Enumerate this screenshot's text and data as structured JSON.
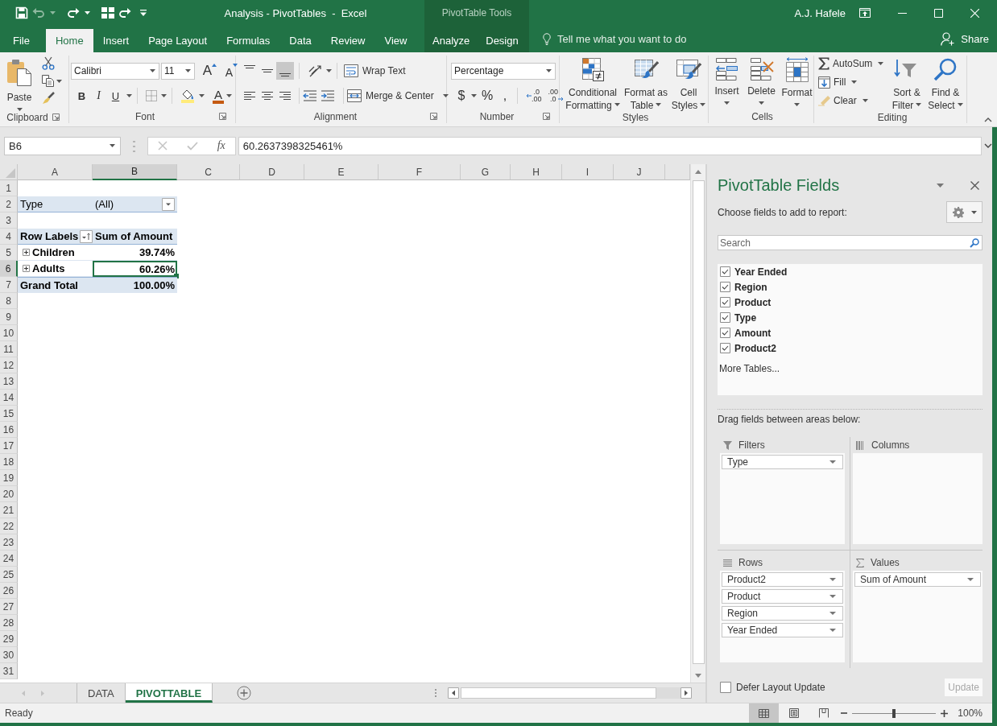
{
  "title_bar": {
    "quick_access": [
      {
        "kind": "save",
        "disabled": false
      },
      {
        "kind": "undo",
        "disabled": true
      },
      {
        "kind": "redo",
        "disabled": false
      },
      {
        "kind": "layout",
        "disabled": false
      },
      {
        "kind": "repeat",
        "disabled": false
      },
      {
        "kind": "customize",
        "disabled": false
      }
    ],
    "title": "Analysis - PivotTables  -  Excel",
    "context_group": "PivotTable Tools",
    "user": "A.J. Hafele"
  },
  "ribbon_tabs": [
    {
      "label": "File",
      "selected": false,
      "contextual": false
    },
    {
      "label": "Home",
      "selected": true,
      "contextual": false
    },
    {
      "label": "Insert",
      "selected": false,
      "contextual": false
    },
    {
      "label": "Page Layout",
      "selected": false,
      "contextual": false
    },
    {
      "label": "Formulas",
      "selected": false,
      "contextual": false
    },
    {
      "label": "Data",
      "selected": false,
      "contextual": false
    },
    {
      "label": "Review",
      "selected": false,
      "contextual": false
    },
    {
      "label": "View",
      "selected": false,
      "contextual": false
    },
    {
      "label": "Analyze",
      "selected": false,
      "contextual": true
    },
    {
      "label": "Design",
      "selected": false,
      "contextual": true
    }
  ],
  "tell_me": {
    "placeholder": "Tell me what you want to do"
  },
  "share_button": {
    "label": "Share"
  },
  "ribbon": {
    "groups": [
      {
        "kind": "clipboard",
        "label": "Clipboard",
        "launcher": true,
        "paste": "Paste"
      },
      {
        "kind": "font",
        "label": "Font",
        "launcher": true,
        "font_name": "Calibri",
        "font_size": "11",
        "grow_font": "A",
        "shrink_font": "A",
        "bold": "B",
        "italic": "I",
        "underline": "U",
        "font_color": "A"
      },
      {
        "kind": "alignment",
        "label": "Alignment",
        "launcher": true,
        "vertical_align": [
          {
            "kind": "top",
            "selected": false
          },
          {
            "kind": "middle",
            "selected": false
          },
          {
            "kind": "bottom",
            "selected": true
          }
        ],
        "horizontal_align": [
          {
            "kind": "left",
            "selected": false
          },
          {
            "kind": "center",
            "selected": false
          },
          {
            "kind": "right",
            "selected": false
          }
        ],
        "wrap_text": "Wrap Text",
        "merge_center": "Merge & Center"
      },
      {
        "kind": "number",
        "label": "Number",
        "launcher": true,
        "format": "Percentage",
        "currency": "$",
        "percent": "%",
        "comma": ",",
        "increase_decimal": [
          ".0",
          ".00"
        ],
        "decrease_decimal": [
          ".00",
          ".0"
        ]
      },
      {
        "kind": "styles",
        "label": "Styles",
        "launcher": false,
        "buttons": [
          {
            "kind": "conditional_formatting",
            "label": "Conditional Formatting"
          },
          {
            "kind": "format_as_table",
            "label": "Format as Table"
          },
          {
            "kind": "cell_styles",
            "label": "Cell Styles"
          }
        ]
      },
      {
        "kind": "cells",
        "label": "Cells",
        "launcher": false,
        "buttons": [
          {
            "kind": "insert",
            "label": "Insert"
          },
          {
            "kind": "delete",
            "label": "Delete"
          },
          {
            "kind": "format",
            "label": "Format"
          }
        ]
      },
      {
        "kind": "editing",
        "label": "Editing",
        "launcher": false,
        "small_buttons": [
          {
            "kind": "autosum",
            "label": "AutoSum"
          },
          {
            "kind": "fill",
            "label": "Fill"
          },
          {
            "kind": "clear",
            "label": "Clear"
          }
        ],
        "buttons": [
          {
            "kind": "sort_filter",
            "label": "Sort & Filter"
          },
          {
            "kind": "find_select",
            "label": "Find & Select"
          }
        ]
      }
    ]
  },
  "formula_bar": {
    "name_box": "B6",
    "buttons": [
      {
        "kind": "cancel",
        "disabled": true
      },
      {
        "kind": "enter",
        "disabled": true
      }
    ],
    "function_label": "fx",
    "value": "60.2637398325461%"
  },
  "sheet": {
    "columns": [
      {
        "label": "A",
        "selected": false
      },
      {
        "label": "B",
        "selected": true
      },
      {
        "label": "C",
        "selected": false
      },
      {
        "label": "D",
        "selected": false
      },
      {
        "label": "E",
        "selected": false
      },
      {
        "label": "F",
        "selected": false
      },
      {
        "label": "G",
        "selected": false
      },
      {
        "label": "H",
        "selected": false
      },
      {
        "label": "I",
        "selected": false
      },
      {
        "label": "J",
        "selected": false
      }
    ],
    "rows": [
      {
        "label": "1",
        "selected": false
      },
      {
        "label": "2",
        "selected": false
      },
      {
        "label": "3",
        "selected": false
      },
      {
        "label": "4",
        "selected": false
      },
      {
        "label": "5",
        "selected": false
      },
      {
        "label": "6",
        "selected": true
      },
      {
        "label": "7",
        "selected": false
      },
      {
        "label": "8",
        "selected": false
      },
      {
        "label": "9",
        "selected": false
      },
      {
        "label": "10",
        "selected": false
      },
      {
        "label": "11",
        "selected": false
      },
      {
        "label": "12",
        "selected": false
      },
      {
        "label": "13",
        "selected": false
      },
      {
        "label": "14",
        "selected": false
      },
      {
        "label": "15",
        "selected": false
      },
      {
        "label": "16",
        "selected": false
      },
      {
        "label": "17",
        "selected": false
      },
      {
        "label": "18",
        "selected": false
      },
      {
        "label": "19",
        "selected": false
      },
      {
        "label": "20",
        "selected": false
      },
      {
        "label": "21",
        "selected": false
      },
      {
        "label": "22",
        "selected": false
      },
      {
        "label": "23",
        "selected": false
      },
      {
        "label": "24",
        "selected": false
      },
      {
        "label": "25",
        "selected": false
      },
      {
        "label": "26",
        "selected": false
      },
      {
        "label": "27",
        "selected": false
      },
      {
        "label": "28",
        "selected": false
      },
      {
        "label": "29",
        "selected": false
      },
      {
        "label": "30",
        "selected": false
      },
      {
        "label": "31",
        "selected": false
      }
    ]
  },
  "pivot_table": {
    "filter": {
      "field": "Type",
      "value": "(All)"
    },
    "header": {
      "row_labels": "Row Labels",
      "values_label": "Sum of Amount"
    },
    "items": [
      {
        "label": "Children",
        "value": "39.74%",
        "expanded": false,
        "selected": false
      },
      {
        "label": "Adults",
        "value": "60.26%",
        "expanded": false,
        "selected": true
      }
    ],
    "grand_total": {
      "label": "Grand Total",
      "value": "100.00%"
    }
  },
  "sheet_tabs": [
    {
      "label": "DATA",
      "selected": false
    },
    {
      "label": "PIVOTTABLE",
      "selected": true
    }
  ],
  "pivot_fields": {
    "title": "PivotTable Fields",
    "subtitle": "Choose fields to add to report:",
    "search": {
      "placeholder": "Search"
    },
    "fields": [
      {
        "label": "Year Ended",
        "checked": true
      },
      {
        "label": "Region",
        "checked": true
      },
      {
        "label": "Product",
        "checked": true
      },
      {
        "label": "Type",
        "checked": true
      },
      {
        "label": "Amount",
        "checked": true
      },
      {
        "label": "Product2",
        "checked": true
      }
    ],
    "more_tables": "More Tables...",
    "areas_hint": "Drag fields between areas below:",
    "areas": [
      {
        "kind": "filters",
        "label": "Filters",
        "items": [
          "Type"
        ]
      },
      {
        "kind": "columns",
        "label": "Columns"
      },
      {
        "kind": "rows",
        "label": "Rows",
        "items": [
          "Product2",
          "Product",
          "Region",
          "Year Ended"
        ]
      },
      {
        "kind": "values",
        "label": "Values",
        "items": [
          "Sum of Amount"
        ]
      }
    ],
    "defer_update": {
      "label": "Defer Layout Update",
      "checked": false
    },
    "update_button": {
      "label": "Update",
      "disabled": true
    }
  },
  "status_bar": {
    "text": "Ready",
    "views": [
      {
        "kind": "normal",
        "selected": true
      },
      {
        "kind": "page_layout",
        "selected": false
      },
      {
        "kind": "page_break",
        "selected": false
      }
    ],
    "zoom": {
      "level": 0.5,
      "label": "100%"
    }
  }
}
